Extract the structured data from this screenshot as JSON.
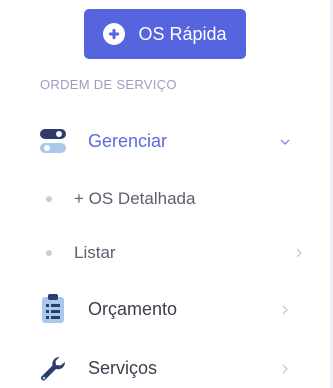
{
  "quick_button": {
    "label": "OS Rápida",
    "icon": "plus-circle-icon"
  },
  "section": {
    "title": "ORDEM DE SERVIÇO"
  },
  "menu": [
    {
      "label": "Gerenciar",
      "icon": "toggle-switch-icon",
      "expanded": true,
      "active": true
    },
    {
      "label": "Orçamento",
      "icon": "clipboard-icon",
      "expanded": false,
      "active": false
    },
    {
      "label": "Serviços",
      "icon": "wrench-icon",
      "expanded": false,
      "active": false
    }
  ],
  "submenu": [
    {
      "label": "+ OS Detalhada",
      "has_chevron": false
    },
    {
      "label": "Listar",
      "has_chevron": true
    }
  ],
  "colors": {
    "accent": "#5a6bdd",
    "button": "#5764e0",
    "section_label": "#9a9fc3",
    "text": "#3b4050",
    "icon_dark": "#2d3c6b",
    "icon_light": "#a8c8ee"
  }
}
